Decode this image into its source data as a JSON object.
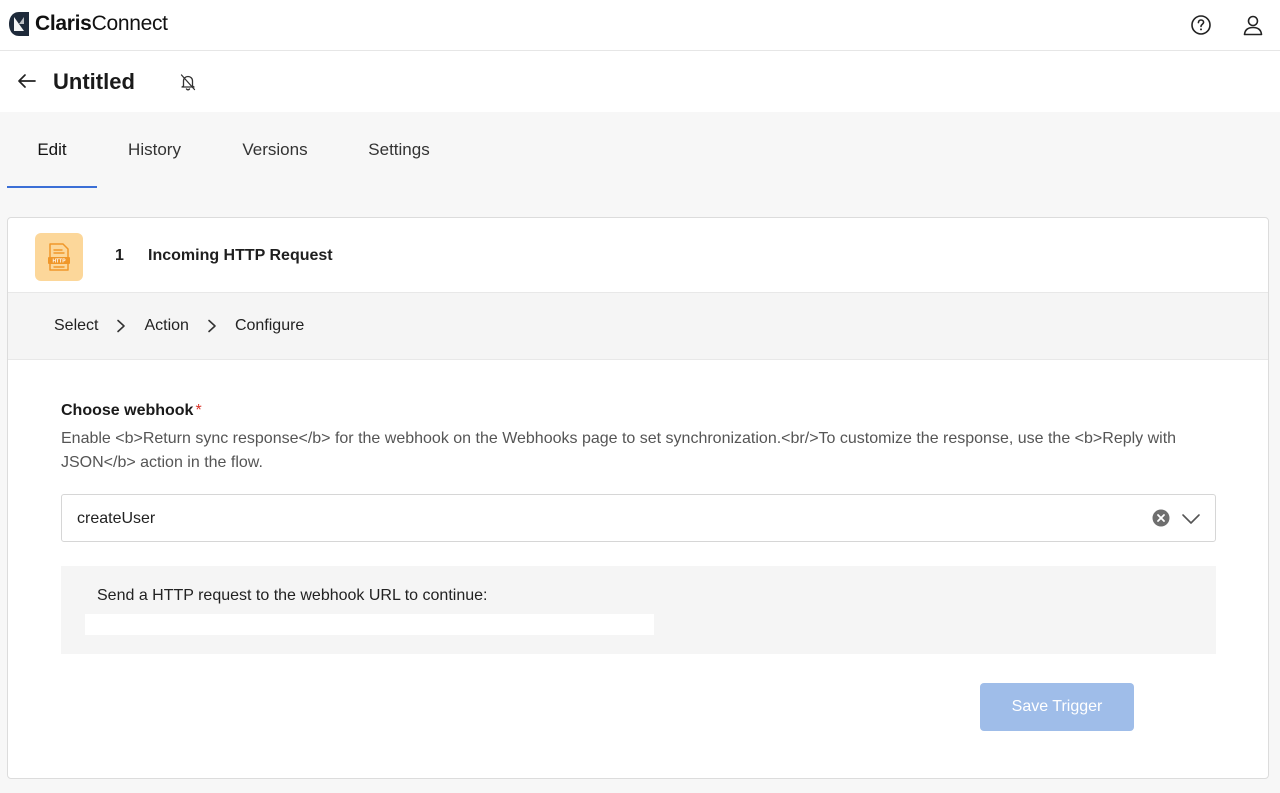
{
  "brand": {
    "name_bold": "Claris",
    "name_regular": "Connect",
    "logo_icon": "claris-logo-icon"
  },
  "topbar": {
    "help_icon": "help-circle-icon",
    "account_icon": "user-icon"
  },
  "header": {
    "title": "Untitled",
    "back_icon": "arrow-left-icon",
    "notify_icon": "bell-off-icon"
  },
  "tabs": [
    {
      "label": "Edit",
      "active": true
    },
    {
      "label": "History",
      "active": false
    },
    {
      "label": "Versions",
      "active": false
    },
    {
      "label": "Settings",
      "active": false
    }
  ],
  "step": {
    "number": "1",
    "title": "Incoming HTTP Request",
    "icon": "http-document-icon",
    "icon_bg": "#fcd79a",
    "icon_color": "#f0972a"
  },
  "breadcrumb": {
    "items": [
      "Select",
      "Action",
      "Configure"
    ],
    "separator_icon": "chevron-right-icon"
  },
  "webhook": {
    "label": "Choose webhook",
    "required_mark": "*",
    "help": "Enable <b>Return sync response</b> for the webhook on the Webhooks page to set synchronization.<br/>To customize the response, use the <b>Reply with JSON</b> action in the flow.",
    "value": "createUser",
    "clear_icon": "clear-circle-icon",
    "dropdown_icon": "chevron-down-icon"
  },
  "info": {
    "text": "Send a HTTP request to the webhook URL to continue:",
    "url": ""
  },
  "actions": {
    "save_label": "Save Trigger",
    "save_color": "#9fbde9"
  },
  "colors": {
    "accent": "#3b6fd6",
    "required": "#d93025"
  }
}
